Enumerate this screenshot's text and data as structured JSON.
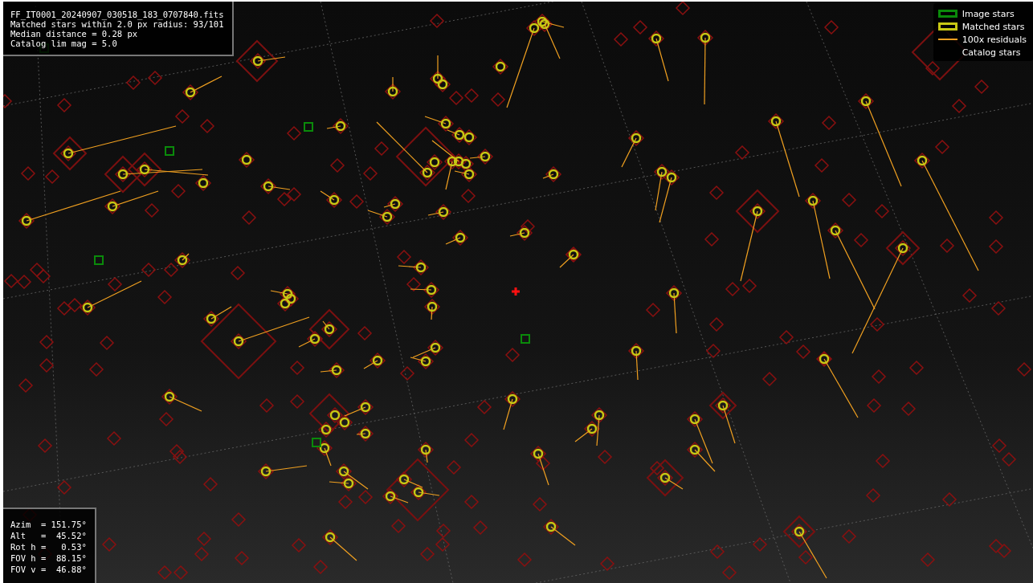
{
  "info_lines": [
    "FF_IT0001_20240907_030518_183_0707840.fits",
    "Matched stars within 2.0 px radius: 93/101",
    "Median distance = 0.28 px",
    "Catalog lim mag = 5.0"
  ],
  "legend": [
    {
      "kind": "image",
      "label": "Image stars"
    },
    {
      "kind": "matched",
      "label": "Matched stars"
    },
    {
      "kind": "residual",
      "label": "100x residuals"
    },
    {
      "kind": "catalog",
      "label": "Catalog stars"
    }
  ],
  "pointing_lines": [
    "Azim  = 151.75°",
    "Alt   =  45.52°",
    "Rot h =   0.53°",
    "FOV h =  88.15°",
    "FOV v =  46.88°"
  ]
}
